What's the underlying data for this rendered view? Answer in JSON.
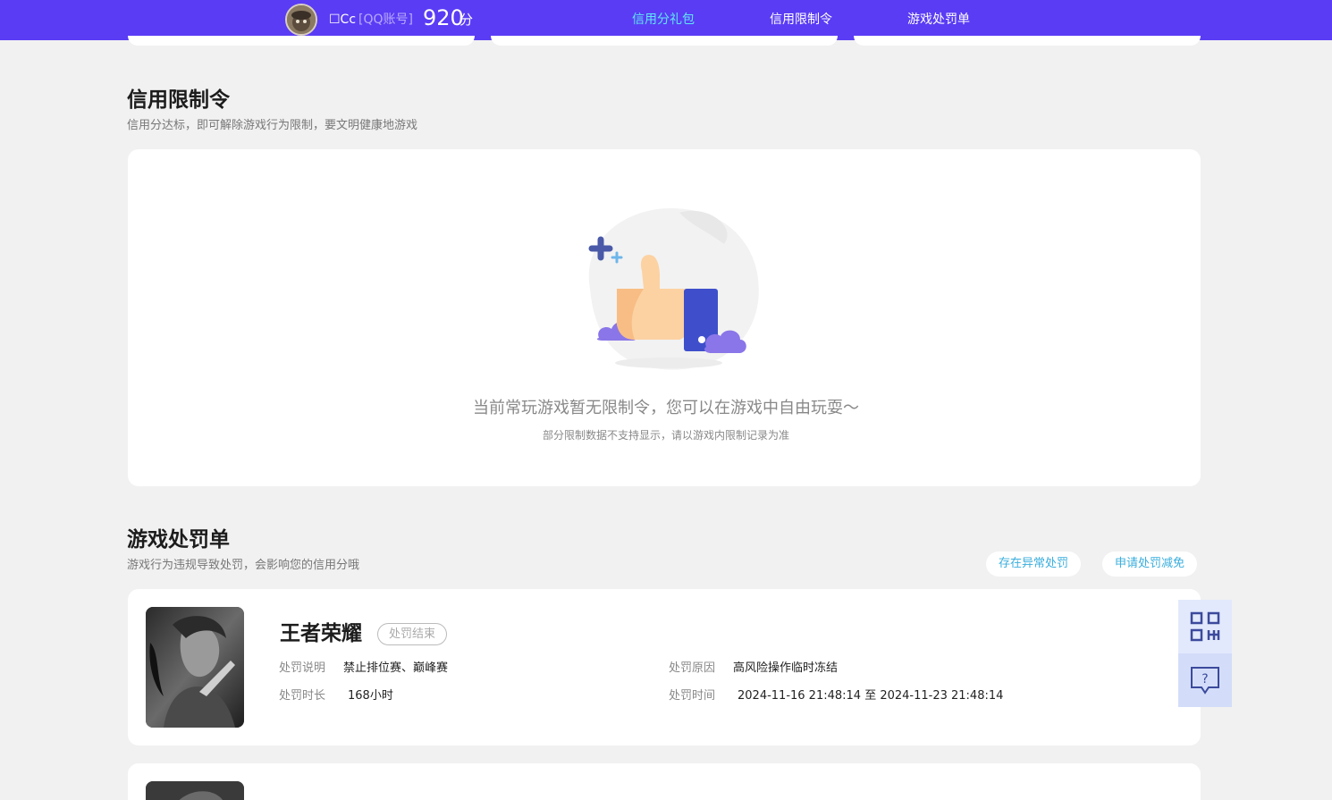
{
  "header": {
    "user_name": "☐Cc",
    "account_type": "[QQ账号]",
    "score": "920",
    "score_unit": "分",
    "tabs": [
      {
        "label": "信用分礼包",
        "active": true
      },
      {
        "label": "信用限制令",
        "active": false
      },
      {
        "label": "游戏处罚单",
        "active": false
      }
    ]
  },
  "restriction": {
    "title": "信用限制令",
    "subtitle": "信用分达标，即可解除游戏行为限制，要文明健康地游戏",
    "empty_message": "当前常玩游戏暂无限制令，您可以在游戏中自由玩耍～",
    "empty_note": "部分限制数据不支持显示，请以游戏内限制记录为准"
  },
  "penalty": {
    "title": "游戏处罚单",
    "subtitle": "游戏行为违规导致处罚，会影响您的信用分哦",
    "actions": {
      "abnormal": "存在异常处罚",
      "reduce": "申请处罚减免"
    },
    "items": [
      {
        "game": "王者荣耀",
        "status": "处罚结束",
        "desc_label": "处罚说明",
        "desc": "禁止排位赛、巅峰赛",
        "reason_label": "处罚原因",
        "reason": "高风险操作临时冻结",
        "duration_label": "处罚时长",
        "duration": "168小时",
        "time_label": "处罚时间",
        "time": "2024-11-16 21:48:14 至 2024-11-23 21:48:14"
      }
    ]
  },
  "colors": {
    "header_bg": "#5a3cf5",
    "active_tab": "#5ee7f5",
    "link": "#3aaedd"
  }
}
